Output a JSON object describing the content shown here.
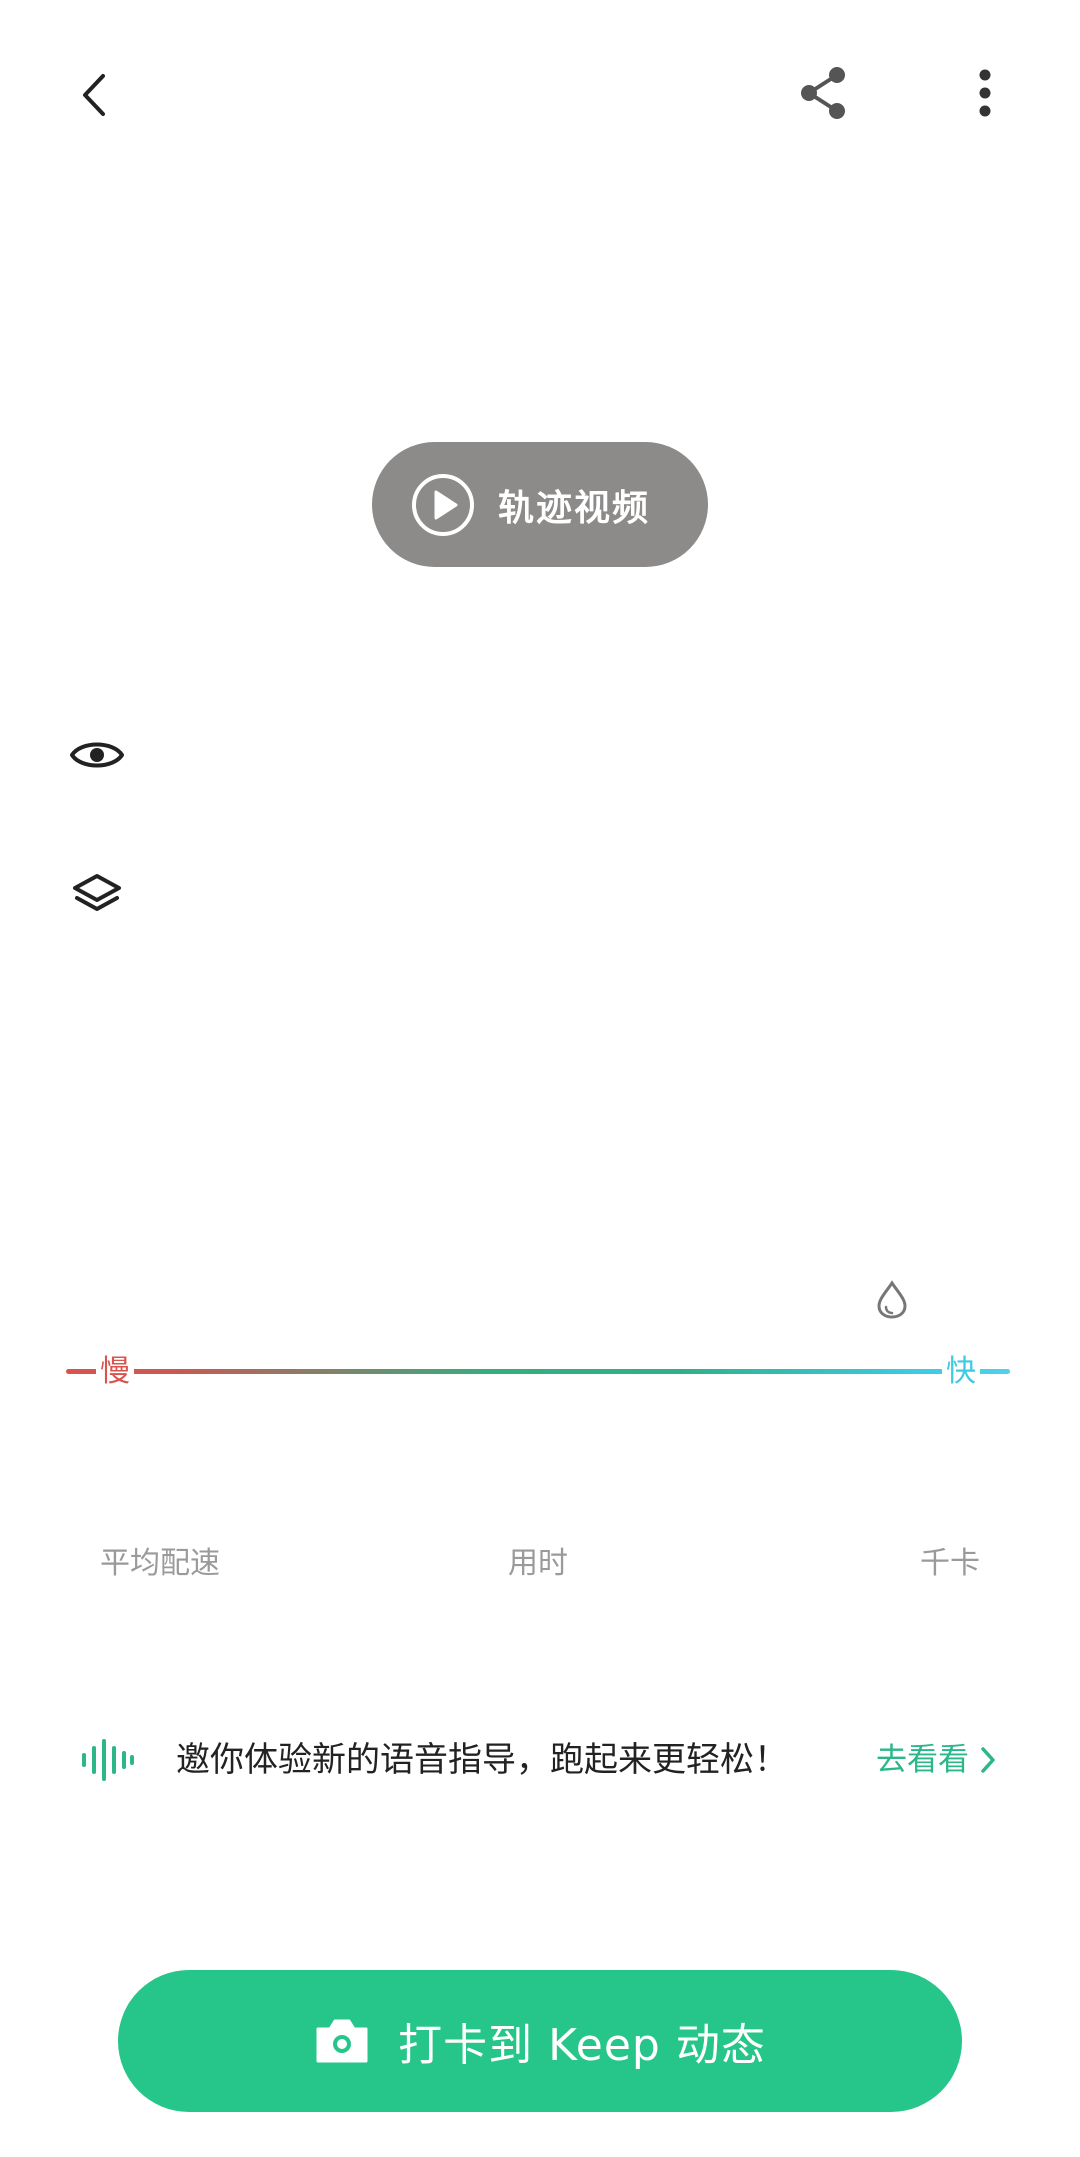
{
  "topbar": {
    "back_icon": "chevron-left-icon",
    "share_icon": "share-icon",
    "more_icon": "more-vertical-icon"
  },
  "map": {
    "track_video_label": "轨迹视频",
    "eye_icon": "eye-icon",
    "layers_icon": "layers-icon",
    "drop_icon": "water-drop-icon"
  },
  "speed_legend": {
    "slow": "慢",
    "fast": "快",
    "colors": {
      "slow": "#d9534f",
      "mid": "#36ad7e",
      "fast": "#4dd2ea"
    }
  },
  "stats": {
    "labels": [
      "平均配速",
      "用时",
      "千卡"
    ]
  },
  "voice_card": {
    "text": "邀你体验新的语音指导，跑起来更轻松！",
    "link": "去看看",
    "accent": "#2bb789"
  },
  "checkin": {
    "label": "打卡到 Keep 动态",
    "color": "#26c68a"
  }
}
